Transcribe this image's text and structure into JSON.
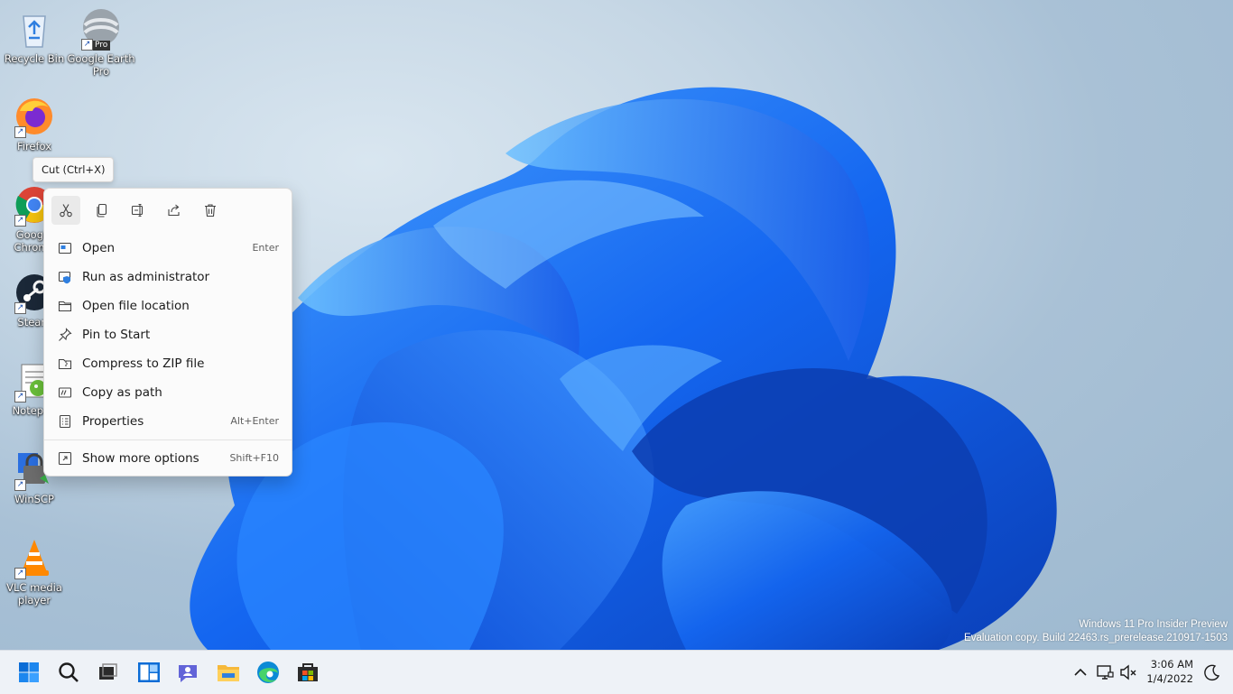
{
  "desktop": {
    "icons": [
      {
        "label": "Recycle Bin",
        "icon": "recycle-bin-icon"
      },
      {
        "label": "Google Earth Pro",
        "icon": "google-earth-icon",
        "badge": "Pro"
      },
      {
        "label": "Firefox",
        "icon": "firefox-icon"
      },
      {
        "label": "Google Chrome",
        "icon": "chrome-icon"
      },
      {
        "label": "Steam",
        "icon": "steam-icon"
      },
      {
        "label": "Notepad",
        "icon": "notepad-icon"
      },
      {
        "label": "WinSCP",
        "icon": "winscp-icon"
      },
      {
        "label": "VLC media player",
        "icon": "vlc-icon"
      }
    ]
  },
  "tooltip": {
    "text": "Cut (Ctrl+X)"
  },
  "context_menu": {
    "quick_actions": [
      {
        "name": "cut",
        "icon": "scissors-icon"
      },
      {
        "name": "copy",
        "icon": "copy-icon"
      },
      {
        "name": "rename",
        "icon": "rename-icon"
      },
      {
        "name": "share",
        "icon": "share-icon"
      },
      {
        "name": "delete",
        "icon": "trash-icon"
      }
    ],
    "items": [
      {
        "label": "Open",
        "shortcut": "Enter",
        "icon": "open-icon"
      },
      {
        "label": "Run as administrator",
        "shortcut": "",
        "icon": "shield-icon"
      },
      {
        "label": "Open file location",
        "shortcut": "",
        "icon": "folder-icon"
      },
      {
        "label": "Pin to Start",
        "shortcut": "",
        "icon": "pin-icon"
      },
      {
        "label": "Compress to ZIP file",
        "shortcut": "",
        "icon": "zip-icon"
      },
      {
        "label": "Copy as path",
        "shortcut": "",
        "icon": "copy-path-icon"
      },
      {
        "label": "Properties",
        "shortcut": "Alt+Enter",
        "icon": "properties-icon"
      },
      {
        "label": "Show more options",
        "shortcut": "Shift+F10",
        "icon": "more-options-icon"
      }
    ]
  },
  "watermark": {
    "line1": "Windows 11 Pro Insider Preview",
    "line2": "Evaluation copy. Build 22463.rs_prerelease.210917-1503"
  },
  "taskbar": {
    "apps": [
      "start-icon",
      "search-icon",
      "task-view-icon",
      "widgets-icon",
      "chat-icon",
      "file-explorer-icon",
      "edge-icon",
      "store-icon"
    ],
    "clock": {
      "time": "3:06 AM",
      "date": "1/4/2022"
    }
  },
  "colors": {
    "accent": "#0067c0",
    "wallpaper_blue": "#1a6ef0"
  }
}
